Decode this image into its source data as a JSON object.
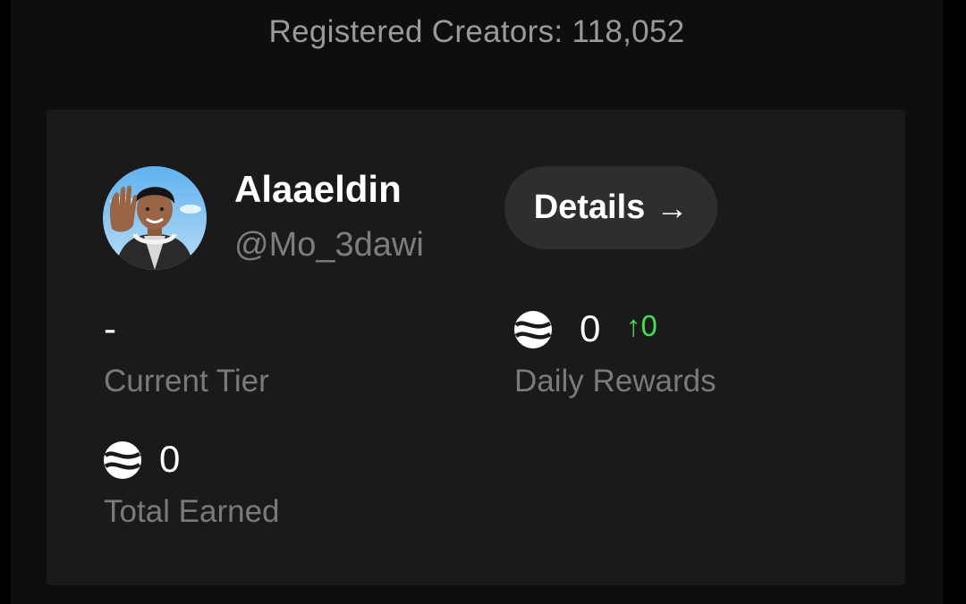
{
  "header": {
    "registered_creators": "Registered Creators: 118,052"
  },
  "profile": {
    "name": "Alaaeldin",
    "handle": "@Mo_3dawi",
    "avatar_icon": "user-avatar"
  },
  "actions": {
    "details_label": "Details",
    "details_arrow": "→"
  },
  "stats": {
    "current_tier": {
      "value": "-",
      "label": "Current Tier"
    },
    "daily_rewards": {
      "value": "0",
      "delta": "↑0",
      "label": "Daily Rewards",
      "icon": "token-coin-icon"
    },
    "total_earned": {
      "value": "0",
      "label": "Total Earned",
      "icon": "token-coin-icon"
    }
  },
  "colors": {
    "background": "#000000",
    "column": "#0e0e0e",
    "card": "#1a1a1a",
    "button": "#2e2e2e",
    "delta_green": "#3fe24f",
    "muted_text": "#7a7a7a"
  }
}
